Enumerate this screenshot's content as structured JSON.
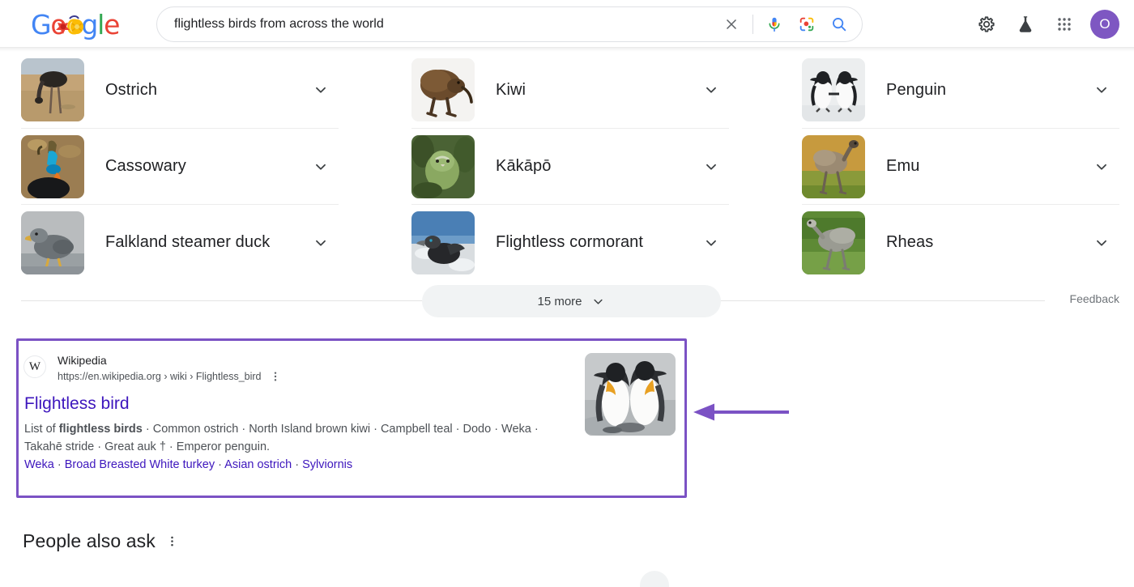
{
  "header": {
    "logo_letters": [
      "G",
      "o",
      "o",
      "g",
      "l",
      "e"
    ],
    "logo_alt": "google-doodle-logo",
    "search": {
      "value": "flightless birds from across the world",
      "placeholder": "Search",
      "clear_icon": "close-icon",
      "voice_icon": "microphone-icon",
      "lens_icon": "google-lens-icon",
      "search_icon": "search-icon"
    },
    "icons": [
      {
        "name": "settings-gear-icon",
        "label": "Settings"
      },
      {
        "name": "labs-flask-icon",
        "label": "Google labs"
      },
      {
        "name": "apps-grid-icon",
        "label": "Google apps"
      }
    ],
    "avatar": {
      "initial": "O",
      "color": "#7e57c2"
    }
  },
  "carousel": {
    "columns": [
      [
        {
          "label": "Ostrich",
          "thumb": "ostrich-thumbnail",
          "expander": "chevron-down-icon"
        },
        {
          "label": "Cassowary",
          "thumb": "cassowary-thumbnail",
          "expander": "chevron-down-icon"
        },
        {
          "label": "Falkland steamer duck",
          "thumb": "falkland-steamer-duck-thumbnail",
          "expander": "chevron-down-icon"
        }
      ],
      [
        {
          "label": "Kiwi",
          "thumb": "kiwi-thumbnail",
          "expander": "chevron-down-icon"
        },
        {
          "label": "Kākāpō",
          "thumb": "kakapo-thumbnail",
          "expander": "chevron-down-icon"
        },
        {
          "label": "Flightless cormorant",
          "thumb": "flightless-cormorant-thumbnail",
          "expander": "chevron-down-icon"
        }
      ],
      [
        {
          "label": "Penguin",
          "thumb": "penguin-thumbnail",
          "expander": "chevron-down-icon"
        },
        {
          "label": "Emu",
          "thumb": "emu-thumbnail",
          "expander": "chevron-down-icon"
        },
        {
          "label": "Rheas",
          "thumb": "rheas-thumbnail",
          "expander": "chevron-down-icon"
        }
      ]
    ],
    "more_button": {
      "label": "15 more",
      "icon": "chevron-down-icon"
    },
    "feedback_label": "Feedback"
  },
  "result": {
    "site_name": "Wikipedia",
    "url": "https://en.wikipedia.org › wiki › Flightless_bird",
    "favicon_letter": "W",
    "title": "Flightless bird",
    "snippet_prefix": "List of ",
    "snippet_bold": "flightless birds",
    "snippet_rest": " · Common ostrich · North Island brown kiwi · Campbell teal · Dodo · Weka · Takahē stride · Great auk † · Emperor penguin.",
    "sitelinks": [
      "Weka",
      "Broad Breasted White turkey",
      "Asian ostrich",
      "Sylviornis"
    ],
    "sitelink_separator": " · ",
    "thumbnail": "king-penguins-thumbnail",
    "menu_icon": "three-dot-menu-icon",
    "annotation": {
      "box_color": "#7b52c4",
      "arrow_icon": "left-arrow-annotation"
    }
  },
  "people_also_ask": {
    "title": "People also ask",
    "menu_icon": "three-dot-menu-icon"
  }
}
